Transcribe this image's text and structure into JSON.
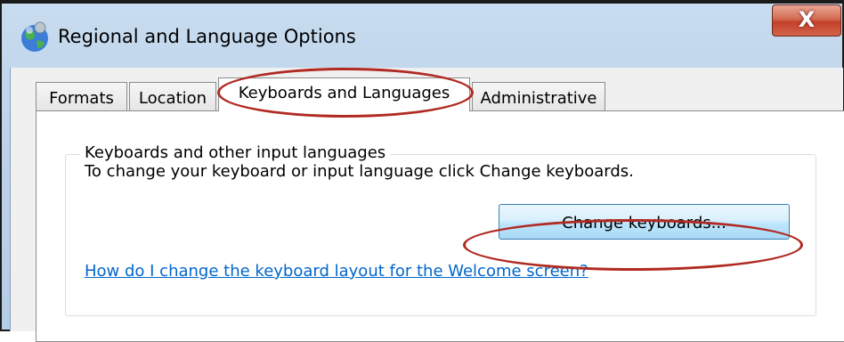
{
  "window": {
    "title": "Regional and Language Options",
    "close_label": "X",
    "icon": "globe-icon"
  },
  "tabs": [
    {
      "label": "Formats",
      "active": false
    },
    {
      "label": "Location",
      "active": false
    },
    {
      "label": "Keyboards and Languages",
      "active": true
    },
    {
      "label": "Administrative",
      "active": false
    }
  ],
  "panel": {
    "group_title": "Keyboards and other input languages",
    "description": "To change your keyboard or input language click Change keyboards.",
    "button_label": "Change keyboards...",
    "link_text": "How do I change the keyboard layout for the Welcome screen?"
  },
  "colors": {
    "highlight_ring": "#b02a22",
    "link": "#0066cc",
    "title_bar": "#bcd3ea"
  }
}
